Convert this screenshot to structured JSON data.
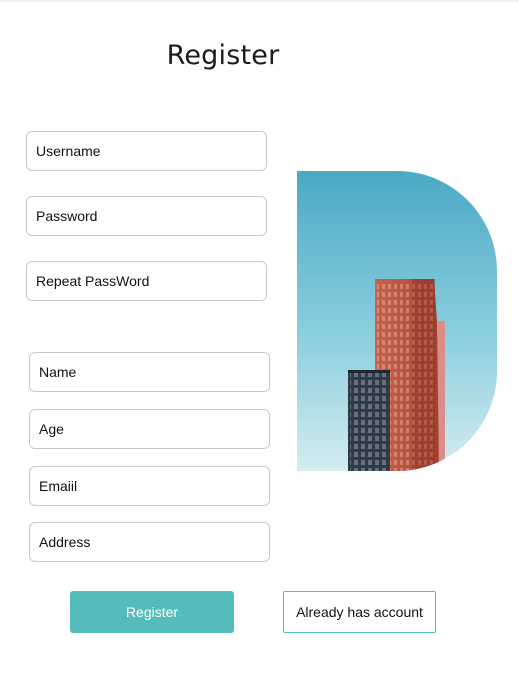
{
  "page": {
    "title": "Register"
  },
  "account_fields": {
    "username_placeholder": "Username",
    "password_placeholder": "Password",
    "repeat_password_placeholder": "Repeat PassWord"
  },
  "profile_fields": {
    "name_placeholder": "Name",
    "age_placeholder": "Age",
    "email_placeholder": "Emaiil",
    "address_placeholder": "Address"
  },
  "actions": {
    "register_label": "Register",
    "has_account_label": "Already has account"
  },
  "colors": {
    "accent": "#55bcbb",
    "sky_top": "#4aa9c4",
    "sky_bottom": "#cfe9ee"
  }
}
